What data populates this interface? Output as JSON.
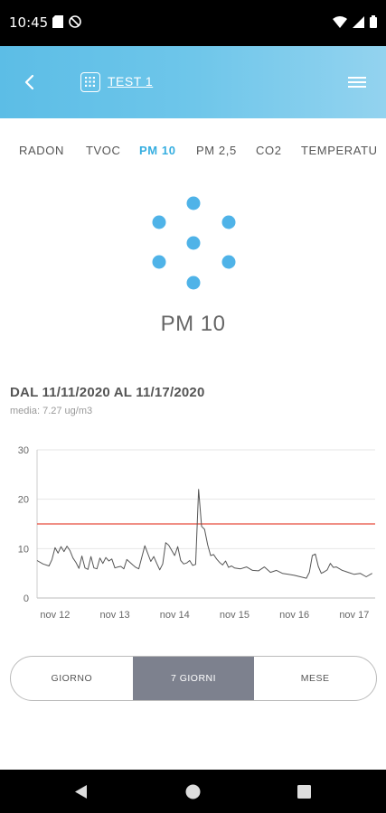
{
  "status_bar": {
    "time": "10:45"
  },
  "header": {
    "title": "TEST 1"
  },
  "tabs": [
    "RADON",
    "TVOC",
    "PM 10",
    "PM 2,5",
    "CO2",
    "TEMPERATU"
  ],
  "active_tab_index": 2,
  "metric": {
    "title": "PM 10"
  },
  "range": {
    "title": "DAL 11/11/2020 AL 11/17/2020",
    "subtitle": "media: 7.27 ug/m3"
  },
  "chart_data": {
    "type": "line",
    "title": "",
    "xlabel": "",
    "ylabel": "",
    "ylim": [
      0,
      30
    ],
    "xlim": [
      11.7,
      17.35
    ],
    "yticks": [
      0,
      10,
      20,
      30
    ],
    "xticks": [
      {
        "value": 12,
        "label": "nov 12"
      },
      {
        "value": 13,
        "label": "nov 13"
      },
      {
        "value": 14,
        "label": "nov 14"
      },
      {
        "value": 15,
        "label": "nov 15"
      },
      {
        "value": 16,
        "label": "nov 16"
      },
      {
        "value": 17,
        "label": "nov 17"
      }
    ],
    "grid": true,
    "threshold": {
      "value": 15,
      "color": "#e74c3c"
    },
    "series": [
      {
        "color": "#555555",
        "x": [
          11.7,
          11.8,
          11.9,
          11.95,
          12.0,
          12.05,
          12.1,
          12.15,
          12.2,
          12.25,
          12.3,
          12.35,
          12.4,
          12.45,
          12.5,
          12.55,
          12.6,
          12.65,
          12.7,
          12.75,
          12.8,
          12.85,
          12.9,
          12.95,
          13.0,
          13.05,
          13.1,
          13.15,
          13.2,
          13.3,
          13.35,
          13.4,
          13.5,
          13.6,
          13.65,
          13.7,
          13.75,
          13.8,
          13.85,
          13.9,
          14.0,
          14.05,
          14.1,
          14.15,
          14.2,
          14.25,
          14.3,
          14.35,
          14.4,
          14.45,
          14.5,
          14.55,
          14.6,
          14.65,
          14.7,
          14.75,
          14.8,
          14.85,
          14.9,
          14.95,
          15.0,
          15.1,
          15.2,
          15.3,
          15.4,
          15.5,
          15.6,
          15.7,
          15.8,
          15.9,
          16.0,
          16.1,
          16.2,
          16.25,
          16.3,
          16.35,
          16.4,
          16.45,
          16.5,
          16.55,
          16.6,
          16.65,
          16.7,
          16.8,
          16.9,
          17.0,
          17.1,
          17.2,
          17.3
        ],
        "y": [
          7.6,
          6.9,
          6.5,
          7.8,
          10.2,
          9.1,
          10.4,
          9.4,
          10.5,
          9.6,
          8.1,
          7.2,
          6.0,
          8.5,
          6.1,
          5.8,
          8.4,
          6.1,
          5.9,
          8.1,
          7.0,
          8.2,
          7.5,
          7.9,
          6.1,
          6.3,
          6.4,
          5.9,
          7.8,
          6.7,
          6.2,
          5.9,
          10.6,
          7.4,
          8.4,
          7.0,
          5.7,
          6.9,
          11.2,
          10.7,
          8.6,
          10.4,
          7.6,
          6.9,
          7.1,
          7.6,
          6.6,
          6.8,
          22.0,
          14.5,
          13.9,
          10.8,
          8.6,
          8.8,
          7.9,
          7.2,
          6.7,
          7.5,
          6.2,
          6.5,
          6.1,
          5.9,
          6.3,
          5.6,
          5.5,
          6.3,
          5.2,
          5.6,
          5.0,
          4.8,
          4.6,
          4.3,
          4.0,
          5.2,
          8.6,
          8.9,
          6.4,
          5.0,
          5.3,
          5.7,
          7.0,
          6.2,
          6.3,
          5.6,
          5.2,
          4.8,
          5.0,
          4.3,
          5.0
        ]
      }
    ]
  },
  "period_toggle": {
    "options": [
      "GIORNO",
      "7 GIORNI",
      "MESE"
    ],
    "active_index": 1
  }
}
